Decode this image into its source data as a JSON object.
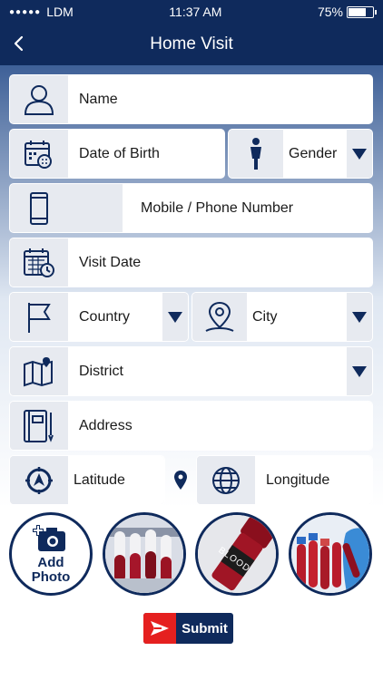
{
  "status": {
    "carrier": "LDM",
    "time": "11:37 AM",
    "battery": "75%",
    "battery_level": 0.75
  },
  "nav": {
    "title": "Home Visit",
    "back_icon": "chevron-left-icon"
  },
  "form": {
    "name_label": "Name",
    "dob_label": "Date of Birth",
    "gender_label": "Gender",
    "mobile_label": "Mobile / Phone Number",
    "visit_date_label": "Visit Date",
    "country_label": "Country",
    "city_label": "City",
    "district_label": "District",
    "address_label": "Address",
    "latitude_label": "Latitude",
    "longitude_label": "Longitude"
  },
  "media": {
    "add_photo_line1": "Add",
    "add_photo_line2": "Photo",
    "blood_label": "BLOOD"
  },
  "actions": {
    "submit_label": "Submit"
  },
  "colors": {
    "primary": "#0f2a5c",
    "accent": "#e5201f",
    "field_bg": "#e7eaf0"
  }
}
